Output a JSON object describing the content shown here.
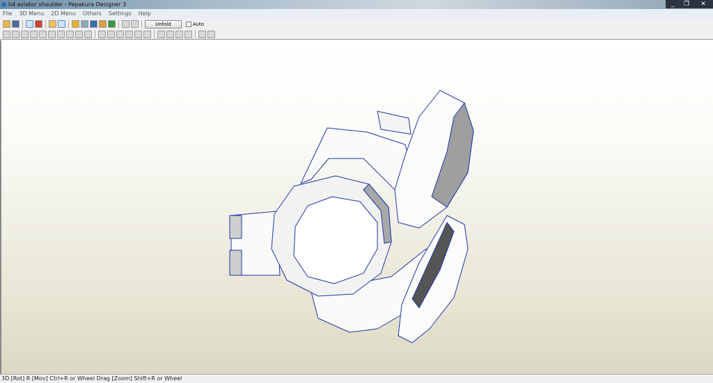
{
  "window": {
    "title": "h4 aviator shoulder - Pepakura Designer 3",
    "controls": [
      "minimize",
      "restore",
      "close"
    ]
  },
  "menu": [
    "File",
    "3D Menu",
    "2D Menu",
    "Others",
    "Settings",
    "Help"
  ],
  "toolbar": {
    "unfold_label": "Unfold",
    "auto_label": "Auto",
    "auto_checked": false
  },
  "status": "3D [Rot] R [Mov] Ctrl+R or Wheel Drag [Zoom] Shift+R or Wheel"
}
